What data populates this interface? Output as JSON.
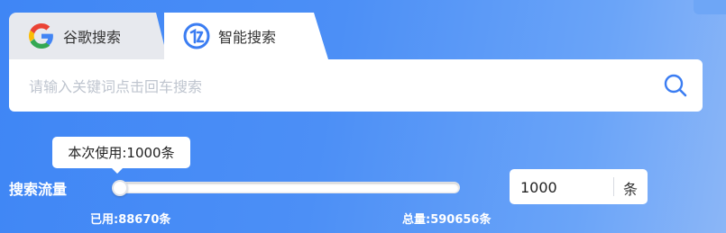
{
  "tabs": [
    {
      "label": "谷歌搜索",
      "icon": "google-icon",
      "active": false
    },
    {
      "label": "智能搜索",
      "icon": "smart-search-logo-icon",
      "active": true
    }
  ],
  "search": {
    "placeholder": "请输入关键词点击回车搜索",
    "value": "",
    "button_icon": "search-icon"
  },
  "flow": {
    "label": "搜索流量",
    "tooltip": "本次使用:1000条",
    "used_text": "已用:88670条",
    "total_text": "总量:590656条",
    "slider_fraction": 0.0,
    "quantity_value": "1000",
    "quantity_unit": "条"
  },
  "colors": {
    "accent": "#3f86f5",
    "icon_blue": "#3b7df2"
  }
}
